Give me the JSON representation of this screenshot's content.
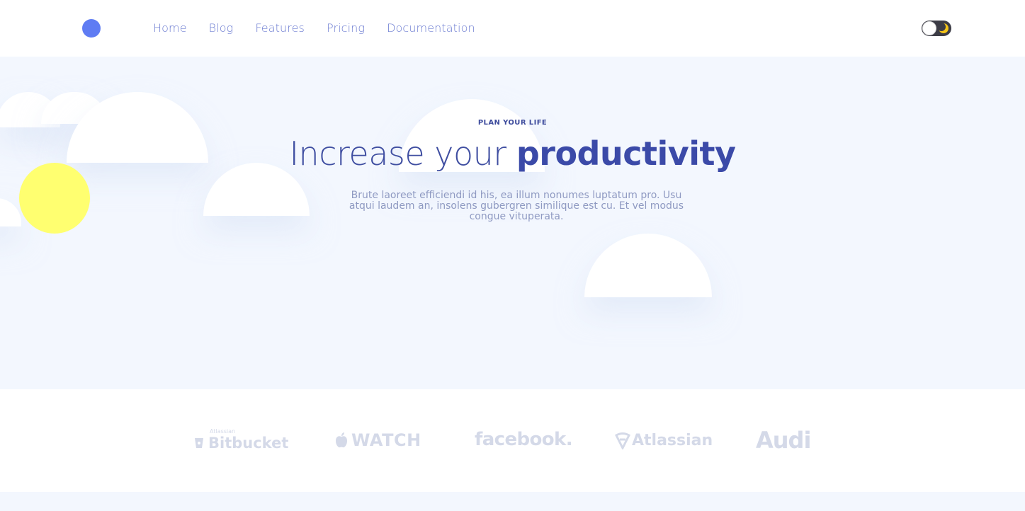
{
  "nav": {
    "items": [
      {
        "label": "Home"
      },
      {
        "label": "Blog"
      },
      {
        "label": "Features"
      },
      {
        "label": "Pricing"
      },
      {
        "label": "Documentation"
      }
    ]
  },
  "theme_toggle": {
    "state": "light"
  },
  "hero": {
    "eyebrow": "PLAN YOUR LIFE",
    "headline_light": "Increase your ",
    "headline_bold": "productivity",
    "subtext": "Brute laoreet efficiendi id his, ea illum nonumes luptatum pro. Usu atqui laudem an, insolens gubergren similique est cu. Et vel modus congue vituperata."
  },
  "logos": {
    "bitbucket_small": "Atlassian",
    "bitbucket": "Bitbucket",
    "watch": "WATCH",
    "facebook": "facebook.",
    "atlassian": "Atlassian",
    "audi": "Audi"
  },
  "colors": {
    "accent": "#5f7cf3",
    "nav_text": "#6b7bd1",
    "heading": "#3f4ea1",
    "hero_bg": "#f3f7fe",
    "sun": "#ffff70",
    "logo_gray": "#d4d9e8"
  }
}
